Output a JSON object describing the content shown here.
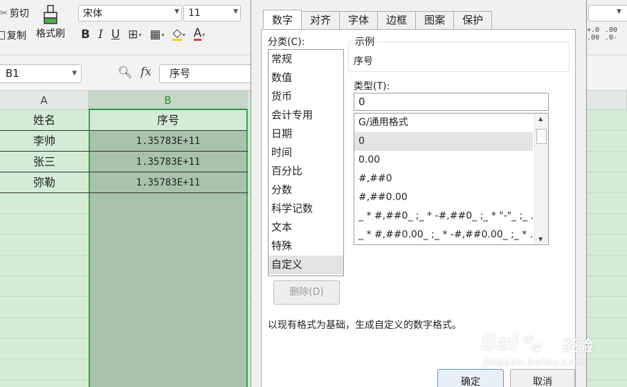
{
  "ribbon": {
    "cut_label": "剪切",
    "copy_label": "复制",
    "format_painter_label": "格式刷",
    "font_name": "宋体",
    "font_size": "11",
    "bold": "B",
    "italic": "I",
    "underline": "U",
    "font_color": "A",
    "decimal_increase": "+.0\n.00",
    "decimal_decrease": ".00\n.0-"
  },
  "formula_bar": {
    "name_box": "B1",
    "fx": "fx",
    "content": "序号"
  },
  "sheet": {
    "columns": [
      "A",
      "B"
    ],
    "rows": [
      {
        "a": "姓名",
        "b": "序号"
      },
      {
        "a": "李帅",
        "b": "1.35783E+11"
      },
      {
        "a": "张三",
        "b": "1.35783E+11"
      },
      {
        "a": "弥勒",
        "b": "1.35783E+11"
      }
    ]
  },
  "dialog": {
    "tabs": [
      "数字",
      "对齐",
      "字体",
      "边框",
      "图案",
      "保护"
    ],
    "active_tab": 0,
    "category_label": "分类(C):",
    "categories": [
      "常规",
      "数值",
      "货币",
      "会计专用",
      "日期",
      "时间",
      "百分比",
      "分数",
      "科学记数",
      "文本",
      "特殊",
      "自定义"
    ],
    "selected_category": 11,
    "sample_title": "示例",
    "sample_value": "序号",
    "type_label": "类型(T):",
    "type_value": "0",
    "types": [
      "G/通用格式",
      "0",
      "0.00",
      "#,##0",
      "#,##0.00",
      "_ * #,##0_ ;_ * -#,##0_ ;_ * \"-\"_ ;_ ...",
      "_ * #,##0.00_ ;_ * -#,##0.00_ ;_ * ..."
    ],
    "selected_type": 1,
    "delete_label": "删除(D)",
    "description": "以现有格式为基础，生成自定义的数字格式。",
    "ok_label": "确定",
    "cancel_label": "取消"
  },
  "watermark": {
    "brand": "Bai",
    "suffix": "经验",
    "url": "jingyan.baidu.com"
  },
  "colors": {
    "grid_bg": "#d4ebd6",
    "selected_col": "#a9c3aa",
    "selection_border": "#3aa14a",
    "dialog_bg": "#f0f0f0"
  }
}
